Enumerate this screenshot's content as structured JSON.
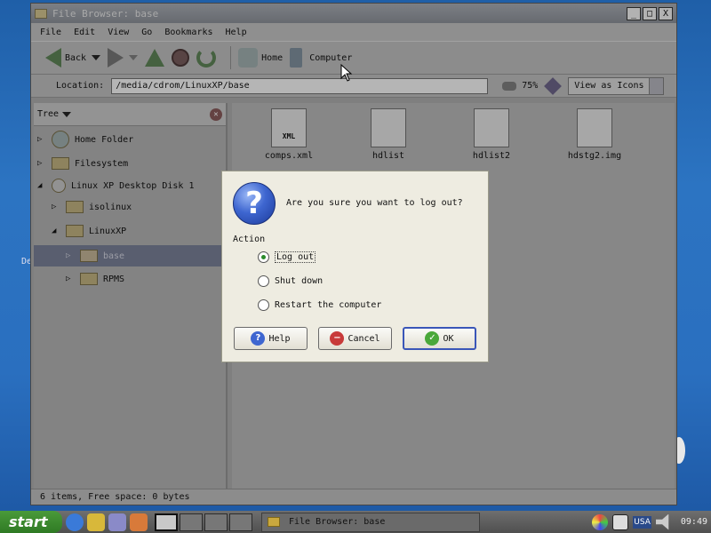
{
  "desktop": {
    "label": "De"
  },
  "window": {
    "title": "File Browser: base",
    "controls": [
      "_",
      "□",
      "X"
    ],
    "menu": [
      "File",
      "Edit",
      "View",
      "Go",
      "Bookmarks",
      "Help"
    ],
    "toolbar": {
      "back": "Back",
      "home": "Home",
      "computer": "Computer"
    },
    "location": {
      "label": "Location:",
      "value": "/media/cdrom/LinuxXP/base",
      "zoom": "75%",
      "view": "View as Icons"
    },
    "sidebar": {
      "header": "Tree",
      "items": [
        {
          "label": "Home Folder",
          "expander": "▷"
        },
        {
          "label": "Filesystem",
          "expander": "▷"
        },
        {
          "label": "Linux XP Desktop Disk 1",
          "expander": "◢"
        },
        {
          "label": "isolinux",
          "expander": "▷"
        },
        {
          "label": "LinuxXP",
          "expander": "◢"
        },
        {
          "label": "base",
          "expander": "▷"
        },
        {
          "label": "RPMS",
          "expander": "▷"
        }
      ]
    },
    "files": [
      {
        "name": "comps.xml",
        "badge": "XML"
      },
      {
        "name": "hdlist"
      },
      {
        "name": "hdlist2"
      },
      {
        "name": "hdstg2.img"
      }
    ],
    "status": "6 items, Free space: 0 bytes"
  },
  "dialog": {
    "question": "Are you sure you want to log out?",
    "action_label": "Action",
    "options": [
      {
        "label": "Log out",
        "selected": true
      },
      {
        "label": "Shut down",
        "selected": false
      },
      {
        "label": "Restart the computer",
        "selected": false
      }
    ],
    "buttons": {
      "help": "Help",
      "cancel": "Cancel",
      "ok": "OK"
    }
  },
  "taskbar": {
    "start": "start",
    "task": "File Browser: base",
    "keyboard": "USA",
    "clock": "09:49"
  }
}
